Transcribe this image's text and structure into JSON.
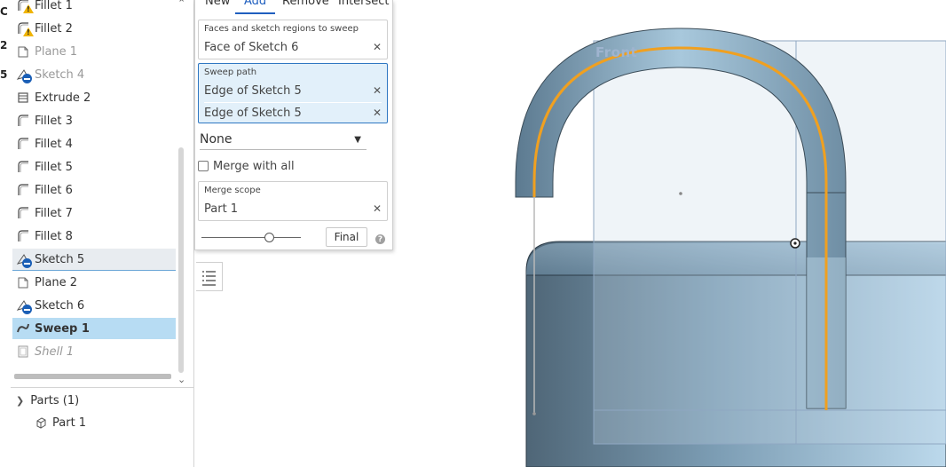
{
  "left_edge": [
    "C",
    "2",
    "5"
  ],
  "tree": {
    "items": [
      {
        "label": "Fillet 1",
        "icon": "fillet-icon",
        "badge": "warning",
        "state": "normal"
      },
      {
        "label": "Fillet 2",
        "icon": "fillet-icon",
        "badge": "warning",
        "state": "normal"
      },
      {
        "label": "Plane 1",
        "icon": "plane-icon",
        "badge": "",
        "state": "suppressed"
      },
      {
        "label": "Sketch 4",
        "icon": "sketch-icon",
        "badge": "minus",
        "state": "suppressed"
      },
      {
        "label": "Extrude 2",
        "icon": "extrude-icon",
        "badge": "",
        "state": "normal"
      },
      {
        "label": "Fillet 3",
        "icon": "fillet-icon",
        "badge": "",
        "state": "normal"
      },
      {
        "label": "Fillet 4",
        "icon": "fillet-icon",
        "badge": "",
        "state": "normal"
      },
      {
        "label": "Fillet 5",
        "icon": "fillet-icon",
        "badge": "",
        "state": "normal"
      },
      {
        "label": "Fillet 6",
        "icon": "fillet-icon",
        "badge": "",
        "state": "normal"
      },
      {
        "label": "Fillet 7",
        "icon": "fillet-icon",
        "badge": "",
        "state": "normal"
      },
      {
        "label": "Fillet 8",
        "icon": "fillet-icon",
        "badge": "",
        "state": "normal"
      },
      {
        "label": "Sketch 5",
        "icon": "sketch-icon",
        "badge": "minus",
        "state": "hover"
      },
      {
        "label": "Plane 2",
        "icon": "plane-icon",
        "badge": "",
        "state": "normal"
      },
      {
        "label": "Sketch 6",
        "icon": "sketch-icon",
        "badge": "minus",
        "state": "normal"
      },
      {
        "label": "Sweep 1",
        "icon": "sweep-icon",
        "badge": "",
        "state": "selected"
      },
      {
        "label": "Shell 1",
        "icon": "shell-icon",
        "badge": "",
        "state": "rolled-back"
      }
    ],
    "parts_header": "Parts (1)",
    "part_label": "Part 1"
  },
  "sweep": {
    "tabs": [
      "New",
      "Add",
      "Remove",
      "Intersect"
    ],
    "active_tab": "Add",
    "faces_label": "Faces and sketch regions to sweep",
    "faces": [
      "Face of Sketch 6"
    ],
    "path_label": "Sweep path",
    "path": [
      "Edge of Sketch 5",
      "Edge of Sketch 5"
    ],
    "profile_control": "None",
    "merge_with_all": "Merge with all",
    "merge_scope_label": "Merge scope",
    "merge_scope": [
      "Part 1"
    ],
    "final_label": "Final",
    "help": "?",
    "slider_fraction": 0.68
  },
  "viewport": {
    "plane_label": "Front",
    "colors": {
      "shackle": "#9ec3dd",
      "body": "#6d8ea6",
      "path": "#f0a020",
      "plane": "#c6d6e6"
    }
  }
}
